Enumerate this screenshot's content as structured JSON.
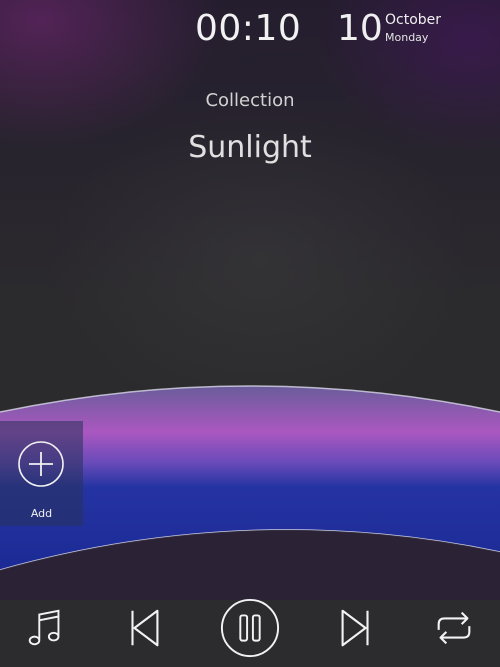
{
  "status": {
    "time": "00:10",
    "day": "10",
    "month": "October",
    "weekday": "Monday"
  },
  "now_playing": {
    "collection": "Collection",
    "title": "Sunlight"
  },
  "add_panel": {
    "label": "Add",
    "icon": "plus-circle-icon"
  },
  "controls": {
    "items": [
      {
        "name": "library",
        "icon": "music-note-icon"
      },
      {
        "name": "previous",
        "icon": "skip-previous-icon"
      },
      {
        "name": "pause",
        "icon": "pause-circle-icon"
      },
      {
        "name": "next",
        "icon": "skip-next-icon"
      },
      {
        "name": "repeat",
        "icon": "repeat-icon"
      }
    ]
  },
  "colors": {
    "accent_blue": "#1c2fa3",
    "accent_pink": "#c85ad2",
    "icon_stroke": "#f2f2f2"
  }
}
